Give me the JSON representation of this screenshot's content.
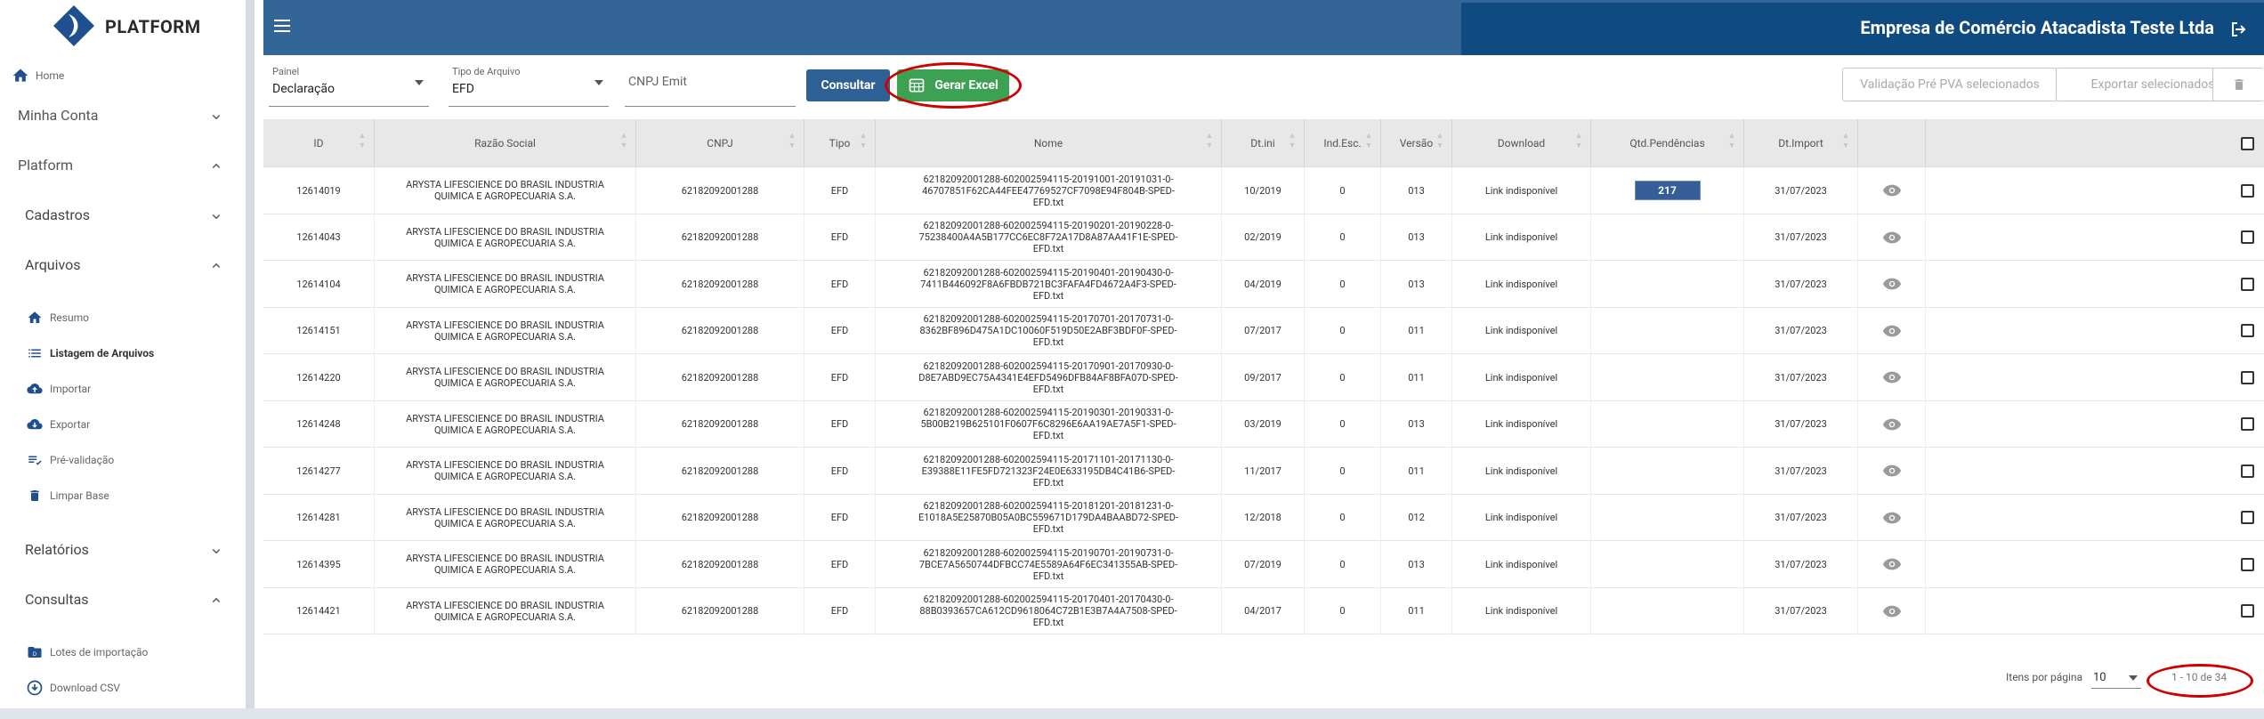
{
  "brand": {
    "name": "PLATFORM"
  },
  "header": {
    "company": "Empresa de Comércio Atacadista Teste Ltda"
  },
  "sidebar": {
    "home": "Home",
    "minha_conta": "Minha Conta",
    "platform": "Platform",
    "cadastros": "Cadastros",
    "arquivos": "Arquivos",
    "arquivos_items": [
      "Resumo",
      "Listagem de Arquivos",
      "Importar",
      "Exportar",
      "Pré-validação",
      "Limpar Base"
    ],
    "relatorios": "Relatórios",
    "consultas": "Consultas",
    "consultas_items": [
      "Lotes de importação",
      "Download CSV"
    ]
  },
  "filters": {
    "painel_label": "Painel",
    "painel_value": "Declaração",
    "tipo_label": "Tipo de Arquivo",
    "tipo_value": "EFD",
    "cnpj_placeholder": "CNPJ Emit",
    "consultar": "Consultar",
    "gerar_excel": "Gerar Excel",
    "validacao": "Validação Pré PVA selecionados",
    "exportar": "Exportar selecionados"
  },
  "table": {
    "headers": [
      "ID",
      "Razão Social",
      "CNPJ",
      "Tipo",
      "Nome",
      "Dt.ini",
      "Ind.Esc.",
      "Versão",
      "Download",
      "Qtd.Pendências",
      "Dt.Import"
    ],
    "rows": [
      {
        "id": "12614019",
        "razao1": "ARYSTA LIFESCIENCE DO BRASIL INDUSTRIA",
        "razao2": "QUIMICA E AGROPECUARIA S.A.",
        "cnpj": "62182092001288",
        "tipo": "EFD",
        "nome1": "62182092001288-602002594115-20191001-20191031-0-",
        "nome2": "46707851F62CA44FEE47769527CF7098E94F804B-SPED-",
        "nome3": "EFD.txt",
        "dtini": "10/2019",
        "indesc": "0",
        "versao": "013",
        "download": "Link indisponível",
        "pend": "217",
        "dtimport": "31/07/2023"
      },
      {
        "id": "12614043",
        "razao1": "ARYSTA LIFESCIENCE DO BRASIL INDUSTRIA",
        "razao2": "QUIMICA E AGROPECUARIA S.A.",
        "cnpj": "62182092001288",
        "tipo": "EFD",
        "nome1": "62182092001288-602002594115-20190201-20190228-0-",
        "nome2": "75238400A4A5B177CC6EC8F72A17D8A87AA41F1E-SPED-",
        "nome3": "EFD.txt",
        "dtini": "02/2019",
        "indesc": "0",
        "versao": "013",
        "download": "Link indisponível",
        "pend": "",
        "dtimport": "31/07/2023"
      },
      {
        "id": "12614104",
        "razao1": "ARYSTA LIFESCIENCE DO BRASIL INDUSTRIA",
        "razao2": "QUIMICA E AGROPECUARIA S.A.",
        "cnpj": "62182092001288",
        "tipo": "EFD",
        "nome1": "62182092001288-602002594115-20190401-20190430-0-",
        "nome2": "7411B446092F8A6FBDB721BC3FAFA4FD4672A4F3-SPED-",
        "nome3": "EFD.txt",
        "dtini": "04/2019",
        "indesc": "0",
        "versao": "013",
        "download": "Link indisponível",
        "pend": "",
        "dtimport": "31/07/2023"
      },
      {
        "id": "12614151",
        "razao1": "ARYSTA LIFESCIENCE DO BRASIL INDUSTRIA",
        "razao2": "QUIMICA E AGROPECUARIA S.A.",
        "cnpj": "62182092001288",
        "tipo": "EFD",
        "nome1": "62182092001288-602002594115-20170701-20170731-0-",
        "nome2": "8362BF896D475A1DC10060F519D50E2ABF3BDF0F-SPED-",
        "nome3": "EFD.txt",
        "dtini": "07/2017",
        "indesc": "0",
        "versao": "011",
        "download": "Link indisponível",
        "pend": "",
        "dtimport": "31/07/2023"
      },
      {
        "id": "12614220",
        "razao1": "ARYSTA LIFESCIENCE DO BRASIL INDUSTRIA",
        "razao2": "QUIMICA E AGROPECUARIA S.A.",
        "cnpj": "62182092001288",
        "tipo": "EFD",
        "nome1": "62182092001288-602002594115-20170901-20170930-0-",
        "nome2": "D8E7ABD9EC75A4341E4EFD5496DFB84AF8BFA07D-SPED-",
        "nome3": "EFD.txt",
        "dtini": "09/2017",
        "indesc": "0",
        "versao": "011",
        "download": "Link indisponível",
        "pend": "",
        "dtimport": "31/07/2023"
      },
      {
        "id": "12614248",
        "razao1": "ARYSTA LIFESCIENCE DO BRASIL INDUSTRIA",
        "razao2": "QUIMICA E AGROPECUARIA S.A.",
        "cnpj": "62182092001288",
        "tipo": "EFD",
        "nome1": "62182092001288-602002594115-20190301-20190331-0-",
        "nome2": "5B00B219B625101F0607F6C8296E6AA19AE7A5F1-SPED-",
        "nome3": "EFD.txt",
        "dtini": "03/2019",
        "indesc": "0",
        "versao": "013",
        "download": "Link indisponível",
        "pend": "",
        "dtimport": "31/07/2023"
      },
      {
        "id": "12614277",
        "razao1": "ARYSTA LIFESCIENCE DO BRASIL INDUSTRIA",
        "razao2": "QUIMICA E AGROPECUARIA S.A.",
        "cnpj": "62182092001288",
        "tipo": "EFD",
        "nome1": "62182092001288-602002594115-20171101-20171130-0-",
        "nome2": "E39388E11FE5FD721323F24E0E633195DB4C41B6-SPED-",
        "nome3": "EFD.txt",
        "dtini": "11/2017",
        "indesc": "0",
        "versao": "011",
        "download": "Link indisponível",
        "pend": "",
        "dtimport": "31/07/2023"
      },
      {
        "id": "12614281",
        "razao1": "ARYSTA LIFESCIENCE DO BRASIL INDUSTRIA",
        "razao2": "QUIMICA E AGROPECUARIA S.A.",
        "cnpj": "62182092001288",
        "tipo": "EFD",
        "nome1": "62182092001288-602002594115-20181201-20181231-0-",
        "nome2": "E1018A5E25870B05A0BC559671D179DA4BAABD72-SPED-",
        "nome3": "EFD.txt",
        "dtini": "12/2018",
        "indesc": "0",
        "versao": "012",
        "download": "Link indisponível",
        "pend": "",
        "dtimport": "31/07/2023"
      },
      {
        "id": "12614395",
        "razao1": "ARYSTA LIFESCIENCE DO BRASIL INDUSTRIA",
        "razao2": "QUIMICA E AGROPECUARIA S.A.",
        "cnpj": "62182092001288",
        "tipo": "EFD",
        "nome1": "62182092001288-602002594115-20190701-20190731-0-",
        "nome2": "7BCE7A5650744DFBCC74E5589A64F6EC341355AB-SPED-",
        "nome3": "EFD.txt",
        "dtini": "07/2019",
        "indesc": "0",
        "versao": "013",
        "download": "Link indisponível",
        "pend": "",
        "dtimport": "31/07/2023"
      },
      {
        "id": "12614421",
        "razao1": "ARYSTA LIFESCIENCE DO BRASIL INDUSTRIA",
        "razao2": "QUIMICA E AGROPECUARIA S.A.",
        "cnpj": "62182092001288",
        "tipo": "EFD",
        "nome1": "62182092001288-602002594115-20170401-20170430-0-",
        "nome2": "88B0393657CA612CD9618064C72B1E3B7A4A7508-SPED-",
        "nome3": "EFD.txt",
        "dtini": "04/2017",
        "indesc": "0",
        "versao": "011",
        "download": "Link indisponível",
        "pend": "",
        "dtimport": "31/07/2023"
      }
    ]
  },
  "pager": {
    "per_page_label": "Itens por página",
    "per_page_value": "10",
    "range": "1 - 10 de 34"
  },
  "colors": {
    "header": "#336596",
    "header_dark": "#0f4a80",
    "primary_button": "#2e5f95",
    "excel_button": "#3ca153",
    "badge": "#355e97",
    "highlight_ellipse": "#d10000"
  }
}
